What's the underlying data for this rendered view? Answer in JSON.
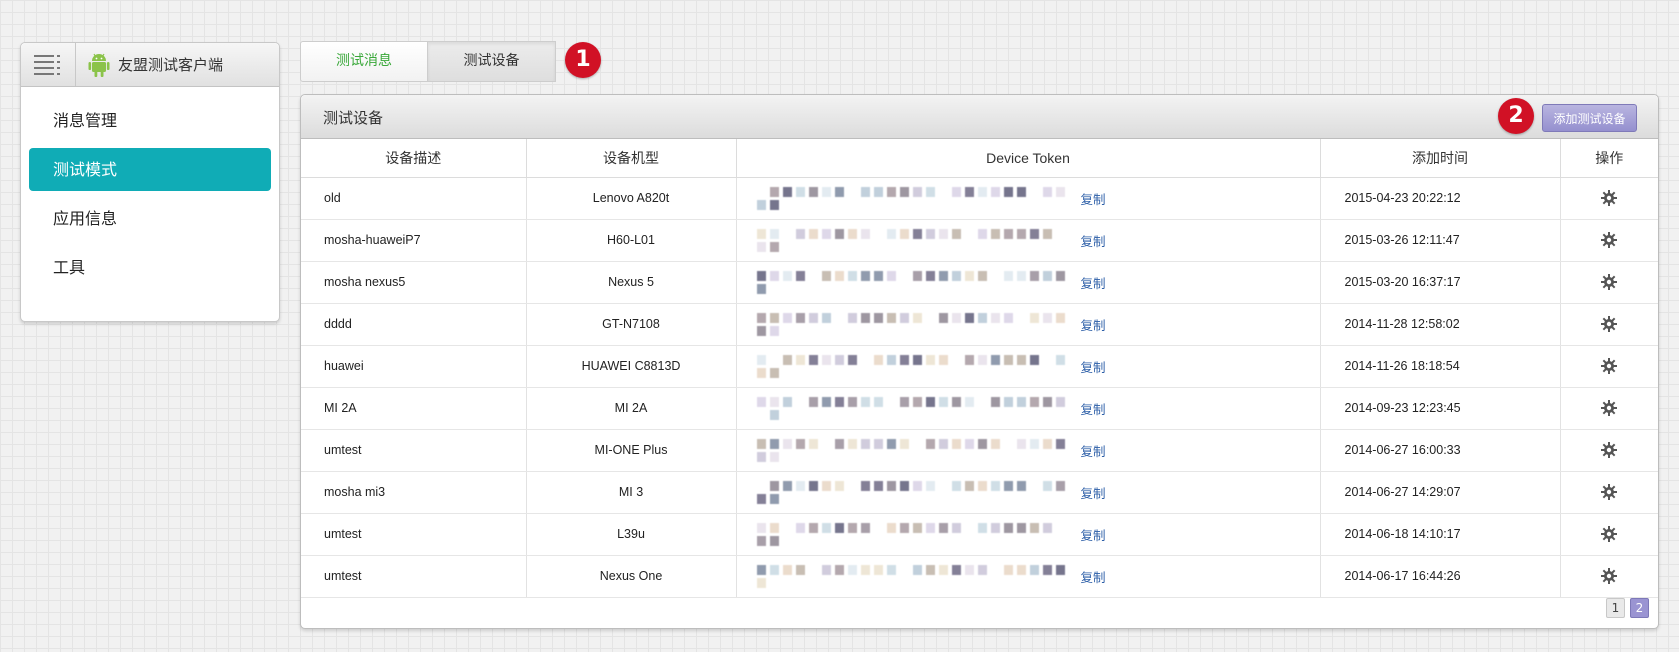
{
  "sidebar": {
    "app_name": "友盟测试客户端",
    "items": [
      {
        "label": "消息管理",
        "active": false
      },
      {
        "label": "测试模式",
        "active": true
      },
      {
        "label": "应用信息",
        "active": false
      },
      {
        "label": "工具",
        "active": false
      }
    ]
  },
  "tabs": [
    {
      "label": "测试消息",
      "active": false
    },
    {
      "label": "测试设备",
      "active": true
    }
  ],
  "badges": {
    "first": "1",
    "second": "2"
  },
  "panel": {
    "title": "测试设备",
    "add_button": "添加测试设备",
    "columns": [
      "设备描述",
      "设备机型",
      "Device Token",
      "添加时间",
      "操作"
    ],
    "copy_label": "复制",
    "rows": [
      {
        "desc": "old",
        "model": "Lenovo A820t",
        "time": "2015-04-23 20:22:12"
      },
      {
        "desc": "mosha-huaweiP7",
        "model": "H60-L01",
        "time": "2015-03-26 12:11:47"
      },
      {
        "desc": "mosha nexus5",
        "model": "Nexus 5",
        "time": "2015-03-20 16:37:17"
      },
      {
        "desc": "dddd",
        "model": "GT-N7108",
        "time": "2014-11-28 12:58:02"
      },
      {
        "desc": "huawei",
        "model": "HUAWEI C8813D",
        "time": "2014-11-26 18:18:54"
      },
      {
        "desc": "MI 2A",
        "model": "MI 2A",
        "time": "2014-09-23 12:23:45"
      },
      {
        "desc": "umtest",
        "model": "MI-ONE Plus",
        "time": "2014-06-27 16:00:33"
      },
      {
        "desc": "mosha mi3",
        "model": "MI 3",
        "time": "2014-06-27 14:29:07"
      },
      {
        "desc": "umtest",
        "model": "L39u",
        "time": "2014-06-18 14:10:17"
      },
      {
        "desc": "umtest",
        "model": "Nexus One",
        "time": "2014-06-17 16:44:26"
      }
    ]
  },
  "pagination": {
    "pages": [
      "1",
      "2"
    ],
    "current": "2"
  },
  "colors": {
    "accent_teal": "#10acb6",
    "tab_green": "#3aa83a",
    "badge_red": "#d11125",
    "button_purple": "#9a94d2",
    "link_blue": "#2d5fa8"
  },
  "icons": {
    "menu": "hamburger-icon",
    "app": "android-icon",
    "operation": "gear-icon"
  }
}
